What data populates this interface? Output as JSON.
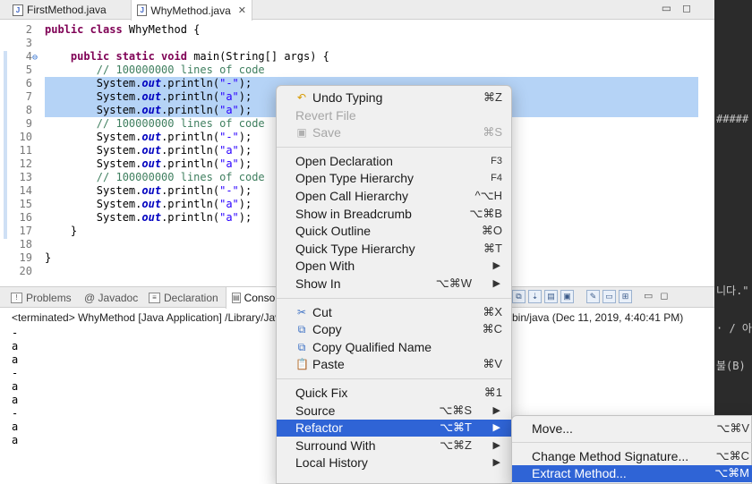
{
  "editor_tabs": [
    {
      "label": "FirstMethod.java",
      "active": false
    },
    {
      "label": "WhyMethod.java",
      "active": true
    }
  ],
  "editor_lines": [
    {
      "n": "2",
      "tokens": [
        {
          "c": "kw",
          "t": "public class "
        },
        {
          "c": "",
          "t": "WhyMethod {"
        }
      ]
    },
    {
      "n": "3",
      "tokens": []
    },
    {
      "n": "4",
      "tokens": [
        {
          "c": "",
          "t": "    "
        },
        {
          "c": "kw",
          "t": "public static void "
        },
        {
          "c": "",
          "t": "main(String[] args) {"
        }
      ]
    },
    {
      "n": "5",
      "tokens": [
        {
          "c": "",
          "t": "        "
        },
        {
          "c": "cm",
          "t": "// 100000000 lines of code"
        }
      ]
    },
    {
      "n": "6",
      "sel": true,
      "tokens": [
        {
          "c": "",
          "t": "        System."
        },
        {
          "c": "fld",
          "t": "out"
        },
        {
          "c": "",
          "t": ".println("
        },
        {
          "c": "st",
          "t": "\"-\""
        },
        {
          "c": "",
          "t": ");"
        }
      ]
    },
    {
      "n": "7",
      "sel": true,
      "tokens": [
        {
          "c": "",
          "t": "        System."
        },
        {
          "c": "fld",
          "t": "out"
        },
        {
          "c": "",
          "t": ".println("
        },
        {
          "c": "st",
          "t": "\"a\""
        },
        {
          "c": "",
          "t": ");"
        }
      ]
    },
    {
      "n": "8",
      "sel": true,
      "tokens": [
        {
          "c": "",
          "t": "        System."
        },
        {
          "c": "fld",
          "t": "out"
        },
        {
          "c": "",
          "t": ".println("
        },
        {
          "c": "st",
          "t": "\"a\""
        },
        {
          "c": "",
          "t": ");"
        }
      ]
    },
    {
      "n": "9",
      "tokens": [
        {
          "c": "",
          "t": "        "
        },
        {
          "c": "cm",
          "t": "// 100000000 lines of code"
        }
      ]
    },
    {
      "n": "10",
      "tokens": [
        {
          "c": "",
          "t": "        System."
        },
        {
          "c": "fld",
          "t": "out"
        },
        {
          "c": "",
          "t": ".println("
        },
        {
          "c": "st",
          "t": "\"-\""
        },
        {
          "c": "",
          "t": ");"
        }
      ]
    },
    {
      "n": "11",
      "tokens": [
        {
          "c": "",
          "t": "        System."
        },
        {
          "c": "fld",
          "t": "out"
        },
        {
          "c": "",
          "t": ".println("
        },
        {
          "c": "st",
          "t": "\"a\""
        },
        {
          "c": "",
          "t": ");"
        }
      ]
    },
    {
      "n": "12",
      "tokens": [
        {
          "c": "",
          "t": "        System."
        },
        {
          "c": "fld",
          "t": "out"
        },
        {
          "c": "",
          "t": ".println("
        },
        {
          "c": "st",
          "t": "\"a\""
        },
        {
          "c": "",
          "t": ");"
        }
      ]
    },
    {
      "n": "13",
      "tokens": [
        {
          "c": "",
          "t": "        "
        },
        {
          "c": "cm",
          "t": "// 100000000 lines of code"
        }
      ]
    },
    {
      "n": "14",
      "tokens": [
        {
          "c": "",
          "t": "        System."
        },
        {
          "c": "fld",
          "t": "out"
        },
        {
          "c": "",
          "t": ".println("
        },
        {
          "c": "st",
          "t": "\"-\""
        },
        {
          "c": "",
          "t": ");"
        }
      ]
    },
    {
      "n": "15",
      "tokens": [
        {
          "c": "",
          "t": "        System."
        },
        {
          "c": "fld",
          "t": "out"
        },
        {
          "c": "",
          "t": ".println("
        },
        {
          "c": "st",
          "t": "\"a\""
        },
        {
          "c": "",
          "t": ");"
        }
      ]
    },
    {
      "n": "16",
      "tokens": [
        {
          "c": "",
          "t": "        System."
        },
        {
          "c": "fld",
          "t": "out"
        },
        {
          "c": "",
          "t": ".println("
        },
        {
          "c": "st",
          "t": "\"a\""
        },
        {
          "c": "",
          "t": ");"
        }
      ]
    },
    {
      "n": "17",
      "tokens": [
        {
          "c": "",
          "t": "    }"
        }
      ]
    },
    {
      "n": "18",
      "tokens": []
    },
    {
      "n": "19",
      "tokens": [
        {
          "c": "",
          "t": "}"
        }
      ]
    },
    {
      "n": "20",
      "tokens": []
    }
  ],
  "view_tabs": [
    {
      "label": "Problems",
      "icon": "problems-icon"
    },
    {
      "label": "@ Javadoc",
      "icon": "javadoc-icon"
    },
    {
      "label": "Declaration",
      "icon": "declaration-icon"
    },
    {
      "label": "Conso",
      "icon": "console-icon"
    }
  ],
  "console": {
    "terminated_prefix": "<terminated> WhyMethod [Java Application] /Library/Jav",
    "terminated_suffix": "bin/java (Dec 11, 2019, 4:40:41 PM)",
    "output": [
      "-",
      "a",
      "a",
      "-",
      "a",
      "a",
      "-",
      "a",
      "a"
    ]
  },
  "right_strip": {
    "hashes": "#####",
    "korean1": "니다.\"",
    "korean2": "· / 아",
    "korean3": "불(B)"
  },
  "context_menu": {
    "groups": [
      [
        {
          "label": "Undo Typing",
          "shortcut": "⌘Z",
          "icon": "undo-icon"
        },
        {
          "label": "Revert File",
          "shortcut": "",
          "disabled": true
        },
        {
          "label": "Save",
          "shortcut": "⌘S",
          "disabled": true,
          "icon": "save-icon"
        }
      ],
      [
        {
          "label": "Open Declaration",
          "shortcut": "F3",
          "small": true
        },
        {
          "label": "Open Type Hierarchy",
          "shortcut": "F4",
          "small": true
        },
        {
          "label": "Open Call Hierarchy",
          "shortcut": "^⌥H"
        },
        {
          "label": "Show in Breadcrumb",
          "shortcut": "⌥⌘B"
        },
        {
          "label": "Quick Outline",
          "shortcut": "⌘O"
        },
        {
          "label": "Quick Type Hierarchy",
          "shortcut": "⌘T"
        },
        {
          "label": "Open With",
          "submenu": true
        },
        {
          "label": "Show In",
          "shortcut": "⌥⌘W",
          "submenu": true
        }
      ],
      [
        {
          "label": "Cut",
          "shortcut": "⌘X",
          "icon": "cut-icon"
        },
        {
          "label": "Copy",
          "shortcut": "⌘C",
          "icon": "copy-icon"
        },
        {
          "label": "Copy Qualified Name",
          "shortcut": "",
          "icon": "copy-qualified-icon"
        },
        {
          "label": "Paste",
          "shortcut": "⌘V",
          "icon": "paste-icon"
        }
      ],
      [
        {
          "label": "Quick Fix",
          "shortcut": "⌘1"
        },
        {
          "label": "Source",
          "shortcut": "⌥⌘S",
          "submenu": true
        },
        {
          "label": "Refactor",
          "shortcut": "⌥⌘T",
          "submenu": true,
          "highlight": true
        },
        {
          "label": "Surround With",
          "shortcut": "⌥⌘Z",
          "submenu": true
        },
        {
          "label": "Local History",
          "submenu": true
        }
      ]
    ]
  },
  "refactor_submenu": [
    {
      "label": "Move...",
      "shortcut": "⌥⌘V"
    },
    {
      "label": "Change Method Signature...",
      "shortcut": "⌥⌘C"
    },
    {
      "label": "Extract Method...",
      "shortcut": "⌥⌘M",
      "highlight": true
    }
  ]
}
